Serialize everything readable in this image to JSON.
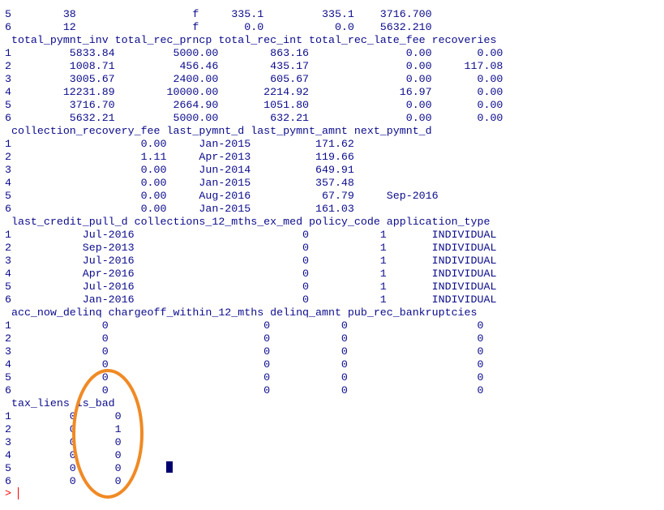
{
  "console_lines": [
    "5        38                  f     335.1         335.1    3716.700",
    "6        12                  f       0.0           0.0    5632.210",
    " total_pymnt_inv total_rec_prncp total_rec_int total_rec_late_fee recoveries",
    "1         5833.84         5000.00        863.16               0.00       0.00",
    "2         1008.71          456.46        435.17               0.00     117.08",
    "3         3005.67         2400.00        605.67               0.00       0.00",
    "4        12231.89        10000.00       2214.92              16.97       0.00",
    "5         3716.70         2664.90       1051.80               0.00       0.00",
    "6         5632.21         5000.00        632.21               0.00       0.00",
    " collection_recovery_fee last_pymnt_d last_pymnt_amnt next_pymnt_d",
    "1                    0.00     Jan-2015          171.62",
    "2                    1.11     Apr-2013          119.66",
    "3                    0.00     Jun-2014          649.91",
    "4                    0.00     Jan-2015          357.48",
    "5                    0.00     Aug-2016           67.79     Sep-2016",
    "6                    0.00     Jan-2015          161.03",
    " last_credit_pull_d collections_12_mths_ex_med policy_code application_type",
    "1           Jul-2016                          0           1       INDIVIDUAL",
    "2           Sep-2013                          0           1       INDIVIDUAL",
    "3           Jul-2016                          0           1       INDIVIDUAL",
    "4           Apr-2016                          0           1       INDIVIDUAL",
    "5           Jul-2016                          0           1       INDIVIDUAL",
    "6           Jan-2016                          0           1       INDIVIDUAL",
    " acc_now_delinq chargeoff_within_12_mths delinq_amnt pub_rec_bankruptcies",
    "1              0                        0           0                    0",
    "2              0                        0           0                    0",
    "3              0                        0           0                    0",
    "4              0                        0           0                    0",
    "5              0                        0           0                    0",
    "6              0                        0           0                    0",
    " tax_liens is_bad",
    "1         0      0",
    "2         0      1",
    "3         0      0",
    "4         0      0",
    "5         0      0",
    "6         0      0"
  ],
  "prompt": {
    "symbol": ">"
  },
  "annotation": {
    "stroke_color": "#f08a24"
  }
}
